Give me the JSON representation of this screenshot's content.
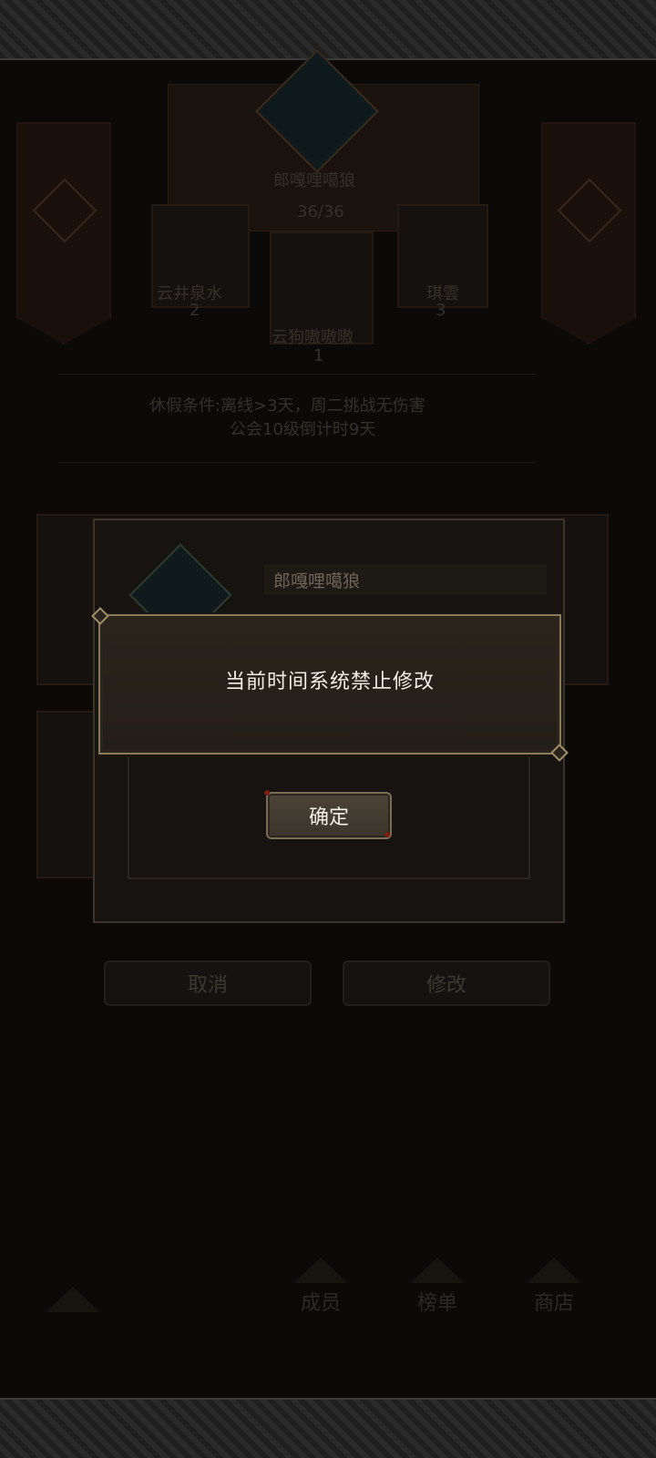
{
  "top_panel": {
    "leader_name": "郎嘎哩噶狼",
    "member_count": "36/36"
  },
  "top_three": [
    {
      "name": "云井泉水",
      "rank": "2"
    },
    {
      "name": "云狗嗷嗷嗷",
      "rank": "1"
    },
    {
      "name": "琪雲",
      "rank": "3"
    }
  ],
  "guild_info": {
    "line1": "休假条件:离线>3天，周二挑战无伤害",
    "line2": "公会10级倒计时9天"
  },
  "edit_dialog": {
    "name_value": "郎嘎哩噶狼"
  },
  "alert": {
    "message": "当前时间系统禁止修改",
    "confirm_label": "确定"
  },
  "actions": {
    "cancel_label": "取消",
    "modify_label": "修改"
  },
  "bottom_nav": {
    "members": "成员",
    "ranking": "榜单",
    "shop": "商店"
  }
}
